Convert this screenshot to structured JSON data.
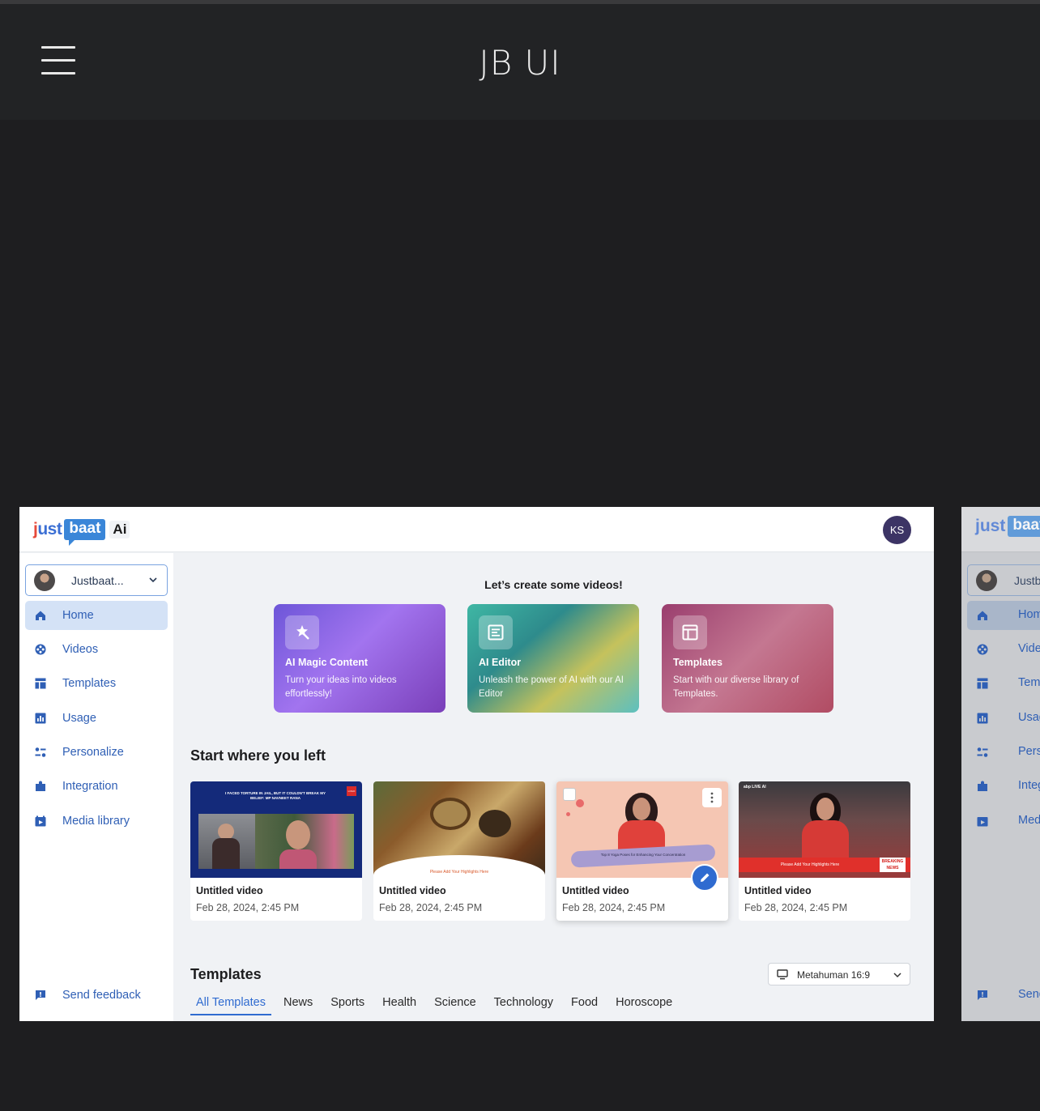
{
  "app": {
    "title": "JB UI"
  },
  "header": {
    "logo_just": "just",
    "logo_baat": "baat",
    "logo_ai": "Ai",
    "user_initials": "KS"
  },
  "sidebar": {
    "workspace": "Justbaat...",
    "items": [
      {
        "label": "Home",
        "icon": "home-icon"
      },
      {
        "label": "Videos",
        "icon": "film-reel-icon"
      },
      {
        "label": "Templates",
        "icon": "layout-icon"
      },
      {
        "label": "Usage",
        "icon": "bar-chart-icon"
      },
      {
        "label": "Personalize",
        "icon": "sliders-icon"
      },
      {
        "label": "Integration",
        "icon": "puzzle-icon"
      },
      {
        "label": "Media library",
        "icon": "media-library-icon"
      }
    ],
    "feedback": "Send feedback"
  },
  "main": {
    "cta_title": "Let’s create some videos!",
    "cards": [
      {
        "title": "AI Magic Content",
        "desc": "Turn your ideas into videos effortlessly!"
      },
      {
        "title": "AI Editor",
        "desc": "Unleash the power of AI with our AI Editor"
      },
      {
        "title": "Templates",
        "desc": "Start with our diverse library of Templates."
      }
    ],
    "recent_title": "Start where you left",
    "videos": [
      {
        "title": "Untitled video",
        "date": "Feb 28, 2024, 2:45 PM",
        "headline": "I FACED TORTURE IN JAIL, BUT IT COULDN'T BREAK MY BELIEF: MP NAVNEET RANA",
        "badge": "LOGO"
      },
      {
        "title": "Untitled video",
        "date": "Feb 28, 2024, 2:45 PM",
        "caption": "Please Add Your Highlights Here"
      },
      {
        "title": "Untitled video",
        "date": "Feb 28, 2024, 2:45 PM",
        "caption": "Top 8 Yoga Poses for Enhancing Your Concentration"
      },
      {
        "title": "Untitled video",
        "date": "Feb 28, 2024, 2:45 PM",
        "caption": "Please Add Your Highlights Here",
        "badge": "BREAKING NEWS",
        "channel": "abp LIVE AI"
      }
    ],
    "templates_title": "Templates",
    "format_select": "Metahuman 16:9",
    "tabs": [
      "All Templates",
      "News",
      "Sports",
      "Health",
      "Science",
      "Technology",
      "Food",
      "Horoscope"
    ]
  },
  "ghost": {
    "logo_just": "just",
    "logo_baat": "baat",
    "workspace": "Justb",
    "items": [
      "Home",
      "Videos",
      "Templa",
      "Usage",
      "Persor",
      "Integra",
      "Media"
    ],
    "feedback": "Send f"
  },
  "colors": {
    "accent": "#2f6bd0",
    "active_nav_bg": "#d4e2f6",
    "avatar_bg": "#3c3465",
    "appbar_bg": "#222325"
  }
}
